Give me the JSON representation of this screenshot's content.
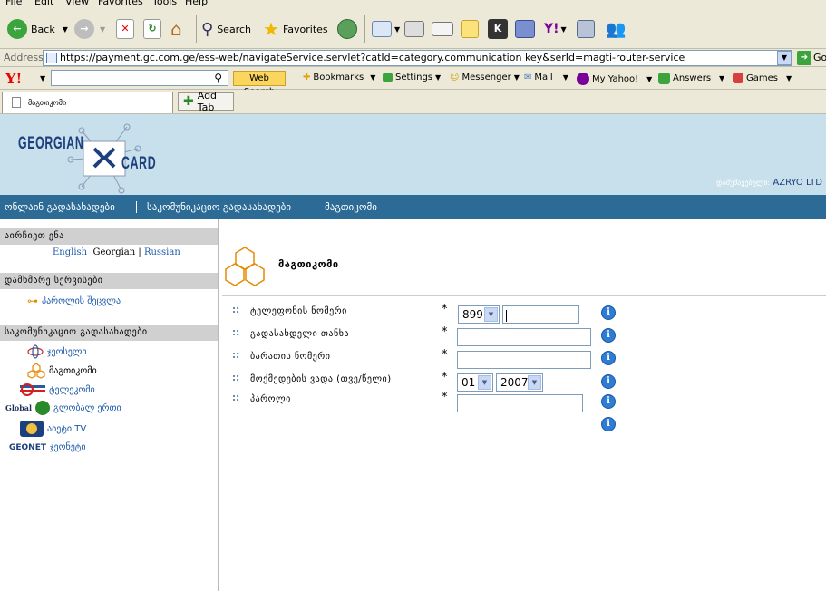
{
  "menu": [
    "File",
    "Edit",
    "View",
    "Favorites",
    "Tools",
    "Help"
  ],
  "toolbar": {
    "back_label": "Back",
    "search_label": "Search",
    "favorites_label": "Favorites"
  },
  "address": {
    "label": "Address",
    "url": "https://payment.gc.com.ge/ess-web/navigateService.servlet?catId=category.communication key&serId=magti-router-service",
    "go_label": "Go"
  },
  "yahoo_toolbar": {
    "logo": "Y!",
    "web_search_label": "Web Search",
    "bookmarks": "Bookmarks",
    "settings": "Settings",
    "messenger": "Messenger",
    "mail": "Mail",
    "my_yahoo": "My Yahoo!",
    "answers": "Answers",
    "games": "Games"
  },
  "tabs": {
    "active_tab_title": "მაგთიკომი",
    "add_tab_label": "Add Tab"
  },
  "header": {
    "logo_word1": "GEORGIAN",
    "logo_word2": "CARD",
    "user_label": "დამუშავებული:",
    "user_name": "AZRYO LTD"
  },
  "nav": {
    "items": [
      "ონლაინ გადასახადები",
      "საკომუნიკაციო გადასახადები",
      "მაგთიკომი"
    ]
  },
  "sidebar": {
    "section_about": "აირჩიეთ ენა",
    "lang_english": "English",
    "lang_georgian": "Georgian",
    "lang_divider": "|",
    "lang_russian": "Russian",
    "section_services": "დამხმარე სერვისები",
    "password_change": "პაროლის შეცვლა",
    "section_payments": "საკომუნიკაციო გადასახადები",
    "links": [
      "ჯეოსელი",
      "მაგთიკომი",
      "ტელეკომი",
      "გლობალ ერთი",
      "აიეტი TV",
      "ჯეონეტი"
    ],
    "globalertv_brand": "Global",
    "geonet_brand": "GEONET"
  },
  "form": {
    "title": "მაგთიკომი",
    "required_mark": "*",
    "info_glyph": "i",
    "fields": [
      {
        "label": "ტელეფონის ნომერი",
        "prefix_value": "899",
        "value": ""
      },
      {
        "label": "გადასახდელი თანხა",
        "value": ""
      },
      {
        "label": "ბარათის ნომერი",
        "value": ""
      },
      {
        "label": "მოქმედების ვადა (თვე/წელი)",
        "month_value": "01",
        "year_value": "2007"
      },
      {
        "label": "პაროლი",
        "value": ""
      }
    ]
  },
  "colors": {
    "nav_bg": "#2d6b97",
    "header_bg": "#c8dfec",
    "logo_blue": "#1c3f7d",
    "side_head_bg": "#d0d0d0",
    "link_blue": "#1c5aa8",
    "info_blue": "#2f7cd4"
  }
}
